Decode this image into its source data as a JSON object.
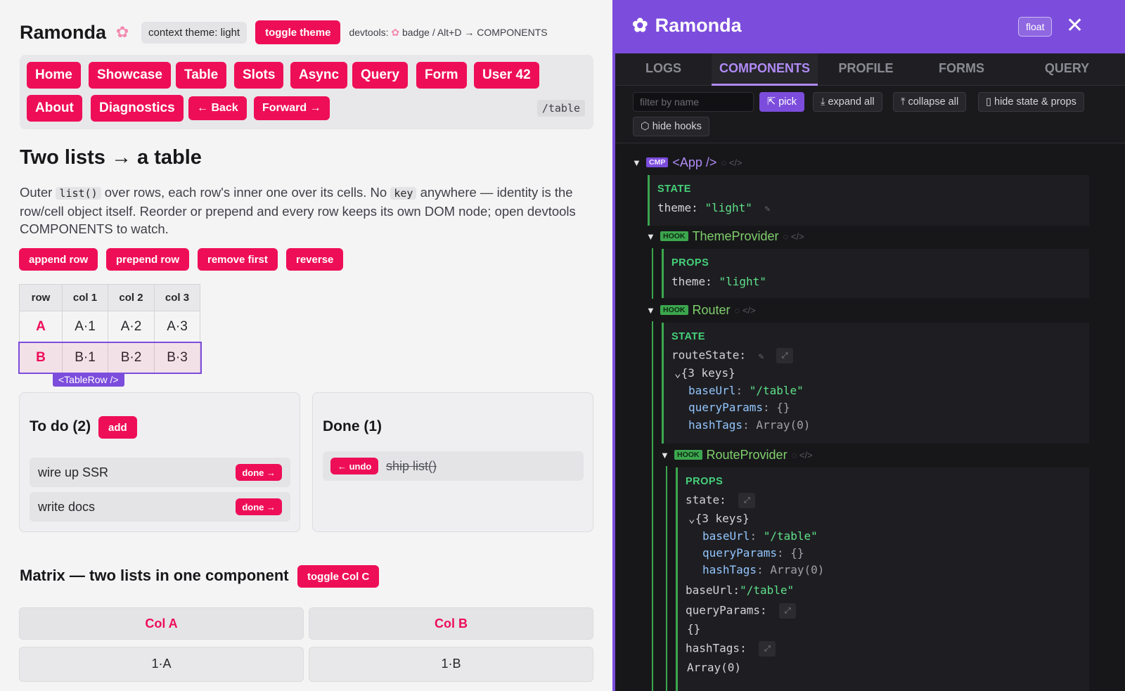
{
  "app": {
    "brand": "Ramonda",
    "context_label": "context theme: light",
    "toggle_theme": "toggle theme",
    "devtools_hint_prefix": "devtools:",
    "devtools_hint_suffix": "badge / Alt+D → COMPONENTS",
    "nav": [
      "Home",
      "Showcase",
      "Table",
      "Slots",
      "Async",
      "Query",
      "Form",
      "User 42",
      "About",
      "Diagnostics",
      "← Back",
      "Forward →"
    ],
    "route_path": "/table",
    "heading": "Two lists → a table",
    "desc_1": "Outer",
    "desc_code_1": "list()",
    "desc_2": "over rows, each row's inner one over its cells. No",
    "desc_code_2": "key",
    "desc_3": "anywhere — identity is the row/cell object itself. Reorder or prepend and every row keeps its own DOM node; open devtools COMPONENTS to watch.",
    "actions": [
      "append row",
      "prepend row",
      "remove first",
      "reverse"
    ],
    "table": {
      "headers": [
        "row",
        "col 1",
        "col 2",
        "col 3"
      ],
      "rows": [
        [
          "A",
          "A·1",
          "A·2",
          "A·3"
        ],
        [
          "B",
          "B·1",
          "B·2",
          "B·3"
        ]
      ],
      "highlight_tag": "<TableRow />"
    },
    "todo": {
      "title": "To do (2)",
      "add": "add",
      "items": [
        "wire up SSR",
        "write docs"
      ],
      "done_label": "done →"
    },
    "done": {
      "title": "Done (1)",
      "undo_label": "← undo",
      "items": [
        "ship list()"
      ]
    },
    "matrix": {
      "heading": "Matrix — two lists in one component",
      "toggle": "toggle Col C",
      "cols": [
        "Col A",
        "Col B"
      ],
      "cells": [
        "1·A",
        "1·B"
      ]
    }
  },
  "devtools": {
    "title": "Ramonda",
    "float": "float",
    "tabs": [
      "LOGS",
      "COMPONENTS",
      "PROFILE",
      "FORMS",
      "QUERY"
    ],
    "active_tab": "COMPONENTS",
    "filter_placeholder": "filter by name",
    "tools": [
      "pick",
      "expand all",
      "collapse all",
      "hide state & props",
      "hide hooks"
    ],
    "tree": {
      "app": {
        "badge": "CMP",
        "name": "<App />"
      },
      "app_state_label": "STATE",
      "app_state_key": "theme:",
      "app_state_val": "\"light\"",
      "theme_provider": {
        "badge": "HOOK",
        "name": "ThemeProvider"
      },
      "tp_props_label": "PROPS",
      "tp_props_key": "theme:",
      "tp_props_val": "\"light\"",
      "router": {
        "badge": "HOOK",
        "name": "Router"
      },
      "router_state_label": "STATE",
      "route_state_key": "routeState:",
      "keys_label": "{3 keys}",
      "base_url_key": "baseUrl",
      "base_url_val": "\"/table\"",
      "query_params_key": "queryParams",
      "query_params_val": "{}",
      "hash_tags_key": "hashTags",
      "hash_tags_val": "Array(0)",
      "route_provider": {
        "badge": "HOOK",
        "name": "RouteProvider"
      },
      "rp_props_label": "PROPS",
      "rp_state_key": "state:",
      "rp_base_url": "baseUrl:",
      "rp_query_params": "queryParams:",
      "rp_hash_tags": "hashTags:"
    }
  }
}
